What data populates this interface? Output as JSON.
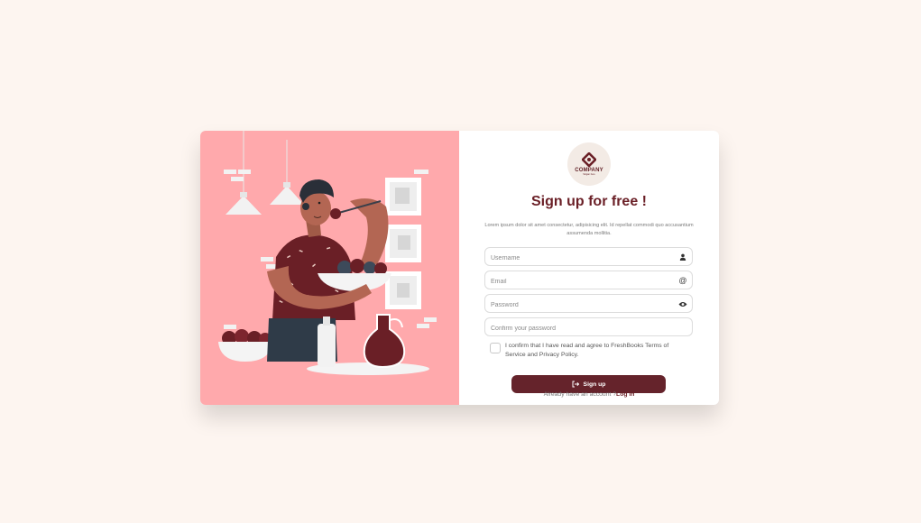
{
  "brand": {
    "name": "COMPANY",
    "tagline": "Slogan here"
  },
  "icons": {
    "logo": "company-logo-icon",
    "username": "person-icon",
    "email": "at-icon",
    "password": "eye-icon",
    "signup": "sign-in-arrow-icon"
  },
  "colors": {
    "primary": "#65232b",
    "title": "#6a1f26",
    "illustration_bg": "#ffa9ac",
    "page_bg": "#fdf5f0"
  },
  "form": {
    "title": "Sign up for free !",
    "description": "Lorem ipsum dolor sit amet consectetur, adipisicing elit. Id repellat commodi quo accusantium assumenda mollitia.",
    "fields": {
      "username": {
        "placeholder": "Username",
        "value": ""
      },
      "email": {
        "placeholder": "Email",
        "value": ""
      },
      "password": {
        "placeholder": "Password",
        "value": ""
      },
      "confirm_password": {
        "placeholder": "Confirm your password",
        "value": ""
      }
    },
    "agreement": "I confirm that I have read and agree to FreshBooks Terms of Service and Privacy Policy.",
    "submit_label": "Sign up",
    "login_prompt": "Already have an account ?",
    "login_link": "Log in"
  }
}
